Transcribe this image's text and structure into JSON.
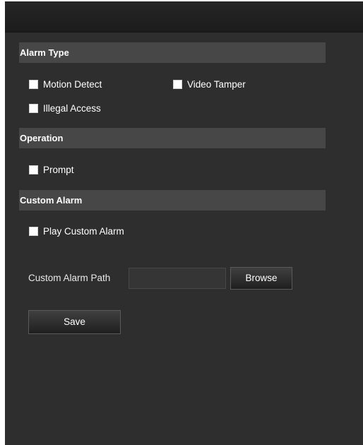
{
  "sections": {
    "alarm_type": {
      "title": "Alarm Type",
      "options": [
        "Motion Detect",
        "Video Tamper",
        "Illegal Access"
      ]
    },
    "operation": {
      "title": "Operation",
      "options": [
        "Prompt"
      ]
    },
    "custom_alarm": {
      "title": "Custom Alarm",
      "play_option": "Play Custom Alarm",
      "path_label": "Custom Alarm Path",
      "path_value": "",
      "browse_label": "Browse"
    }
  },
  "save_label": "Save"
}
